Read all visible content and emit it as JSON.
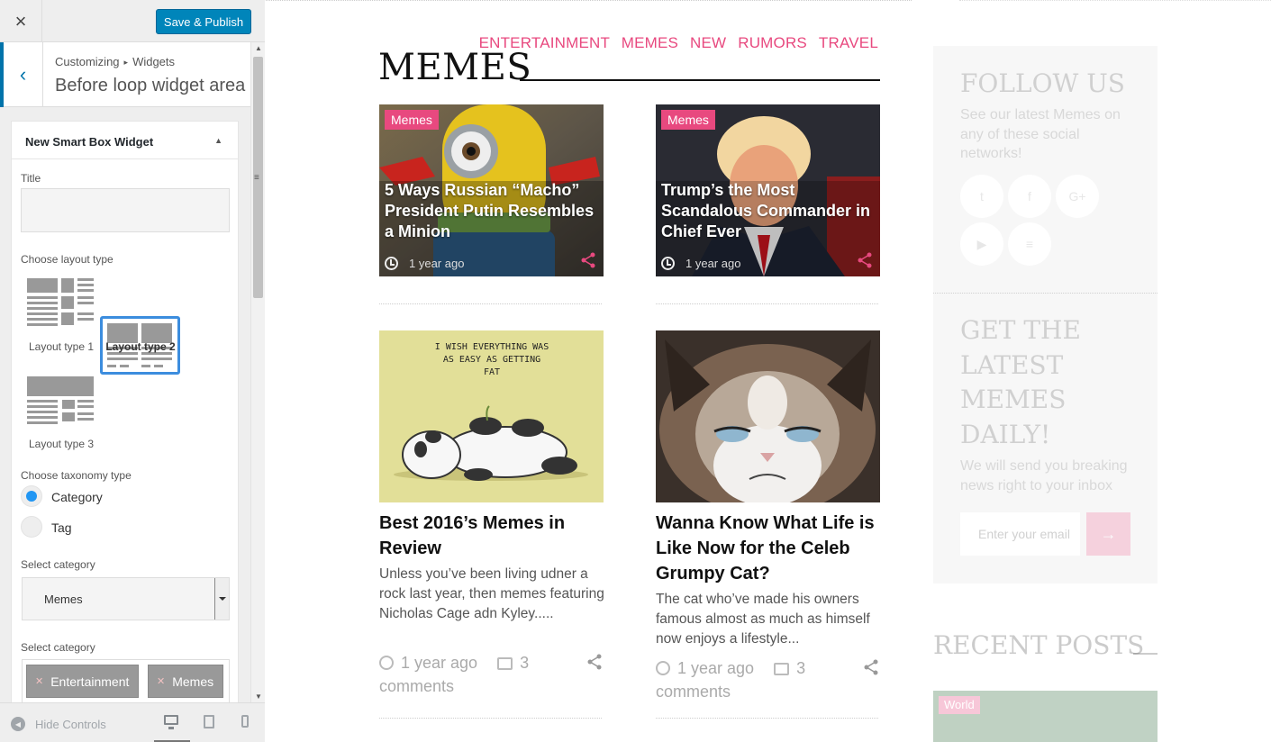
{
  "customizer": {
    "close_label": "×",
    "save_label": "Save & Publish",
    "breadcrumb": [
      "Customizing",
      "Widgets"
    ],
    "section_title": "Before loop widget area",
    "back_label": "‹",
    "widget": {
      "title": "New Smart Box Widget",
      "title_field_label": "Title",
      "title_value": "",
      "layout_label": "Choose layout type",
      "layouts": [
        {
          "label": "Layout type 1",
          "selected": false
        },
        {
          "label": "Layout type 2",
          "selected": true
        },
        {
          "label": "Layout type 3",
          "selected": false
        }
      ],
      "taxonomy_label": "Choose taxonomy type",
      "taxonomy_options": [
        {
          "label": "Category",
          "selected": true
        },
        {
          "label": "Tag",
          "selected": false
        }
      ],
      "select_category_label": "Select category",
      "select_category_value": "Memes",
      "select_category_label_2": "Select category",
      "chips": [
        "Entertainment",
        "Memes"
      ]
    },
    "footer": {
      "hide_controls": "Hide Controls",
      "devices": [
        "desktop-icon",
        "tablet-icon",
        "mobile-icon"
      ]
    }
  },
  "preview": {
    "nav": [
      "ENTERTAINMENT",
      "MEMES",
      "NEW",
      "RUMORS",
      "TRAVEL"
    ],
    "section_title": "MEMES",
    "featured": [
      {
        "badge": "Memes",
        "title": "5 Ways Russian “Macho” President Putin Resembles a Minion",
        "time": "1 year ago"
      },
      {
        "badge": "Memes",
        "title": "Trump’s the Most Scandalous Commander in Chief Ever",
        "time": "1 year ago"
      }
    ],
    "posts": [
      {
        "title": "Best 2016’s Memes in Review",
        "excerpt": "Unless you’ve been living udner a rock last year, then memes featuring Nicholas Cage adn Kyley.....",
        "time": "1 year ago",
        "comments": "3",
        "comments_word": "comments",
        "image_text": "I WISH EVERYTHING WAS AS EASY AS GETTING FAT"
      },
      {
        "title": "Wanna Know What Life is Like Now for the Celeb Grumpy Cat?",
        "excerpt": "The cat who’ve made his owners famous almost as much as himself now enjoys a lifestyle...",
        "time": "1 year ago",
        "comments": "3",
        "comments_word": "comments"
      }
    ],
    "sidebar": {
      "follow_title": "FOLLOW US",
      "follow_text": "See our latest Memes on any of these social networks!",
      "social": [
        "twitter-icon",
        "facebook-icon",
        "google-plus-icon",
        "youtube-icon",
        "rss-icon"
      ],
      "social_glyphs": [
        "t",
        "f",
        "G+",
        "▶",
        "≡"
      ],
      "newsletter_title": "GET THE LATEST MEMES DAILY!",
      "newsletter_text": "We will send you breaking news right to your inbox",
      "email_placeholder": "Enter your email",
      "subscribe_glyph": "→",
      "recent_title": "RECENT POSTS",
      "recent_badge": "World"
    },
    "accent_color": "#e8497f"
  }
}
